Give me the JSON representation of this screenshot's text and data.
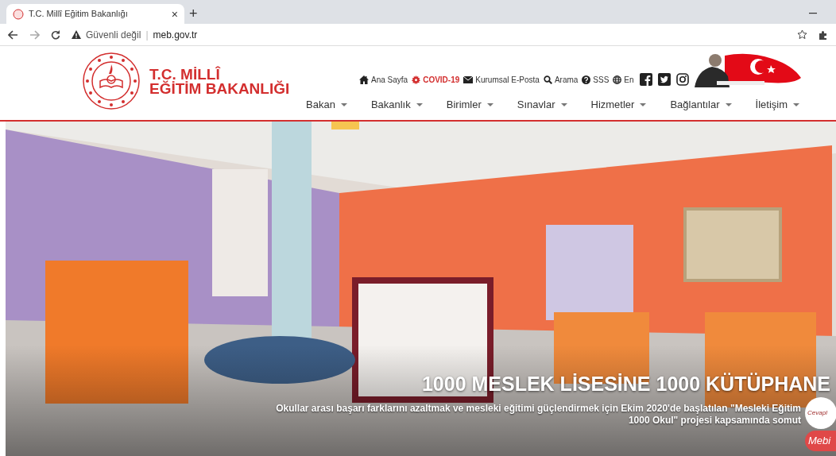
{
  "browser": {
    "tab_title": "T.C. Millî Eğitim Bakanlığı",
    "tab_close": "×",
    "new_tab": "+",
    "security": "Güvenli değil",
    "separator": "|",
    "url": "meb.gov.tr"
  },
  "header": {
    "logo_lines": [
      "T.C. MİLLÎ",
      "EĞİTİM BAKANLIĞI"
    ],
    "top_links": [
      {
        "label": "Ana Sayfa",
        "kind": "normal"
      },
      {
        "label": "COVID-19",
        "kind": "alert"
      },
      {
        "label": "Kurumsal E-Posta",
        "kind": "normal"
      },
      {
        "label": "Arama",
        "kind": "normal"
      },
      {
        "label": "SSS",
        "kind": "normal"
      },
      {
        "label": "En",
        "kind": "normal"
      }
    ],
    "nav": [
      "Bakan",
      "Bakanlık",
      "Birimler",
      "Sınavlar",
      "Hizmetler",
      "Bağlantılar",
      "İletişim"
    ]
  },
  "hero": {
    "title": "1000 MESLEK LİSESİNE 1000 KÜTÜPHANE",
    "caption": [
      "Okullar arası başarı farklarını azaltmak ve mesleki eğitimi güçlendirmek için Ekim 2020'de başlatılan \"Mesleki Eğitim",
      "1000 Okul\" projesi kapsamında somut"
    ]
  },
  "chat_widget": {
    "bubble": "Cevapl",
    "badge": "Mebi"
  }
}
